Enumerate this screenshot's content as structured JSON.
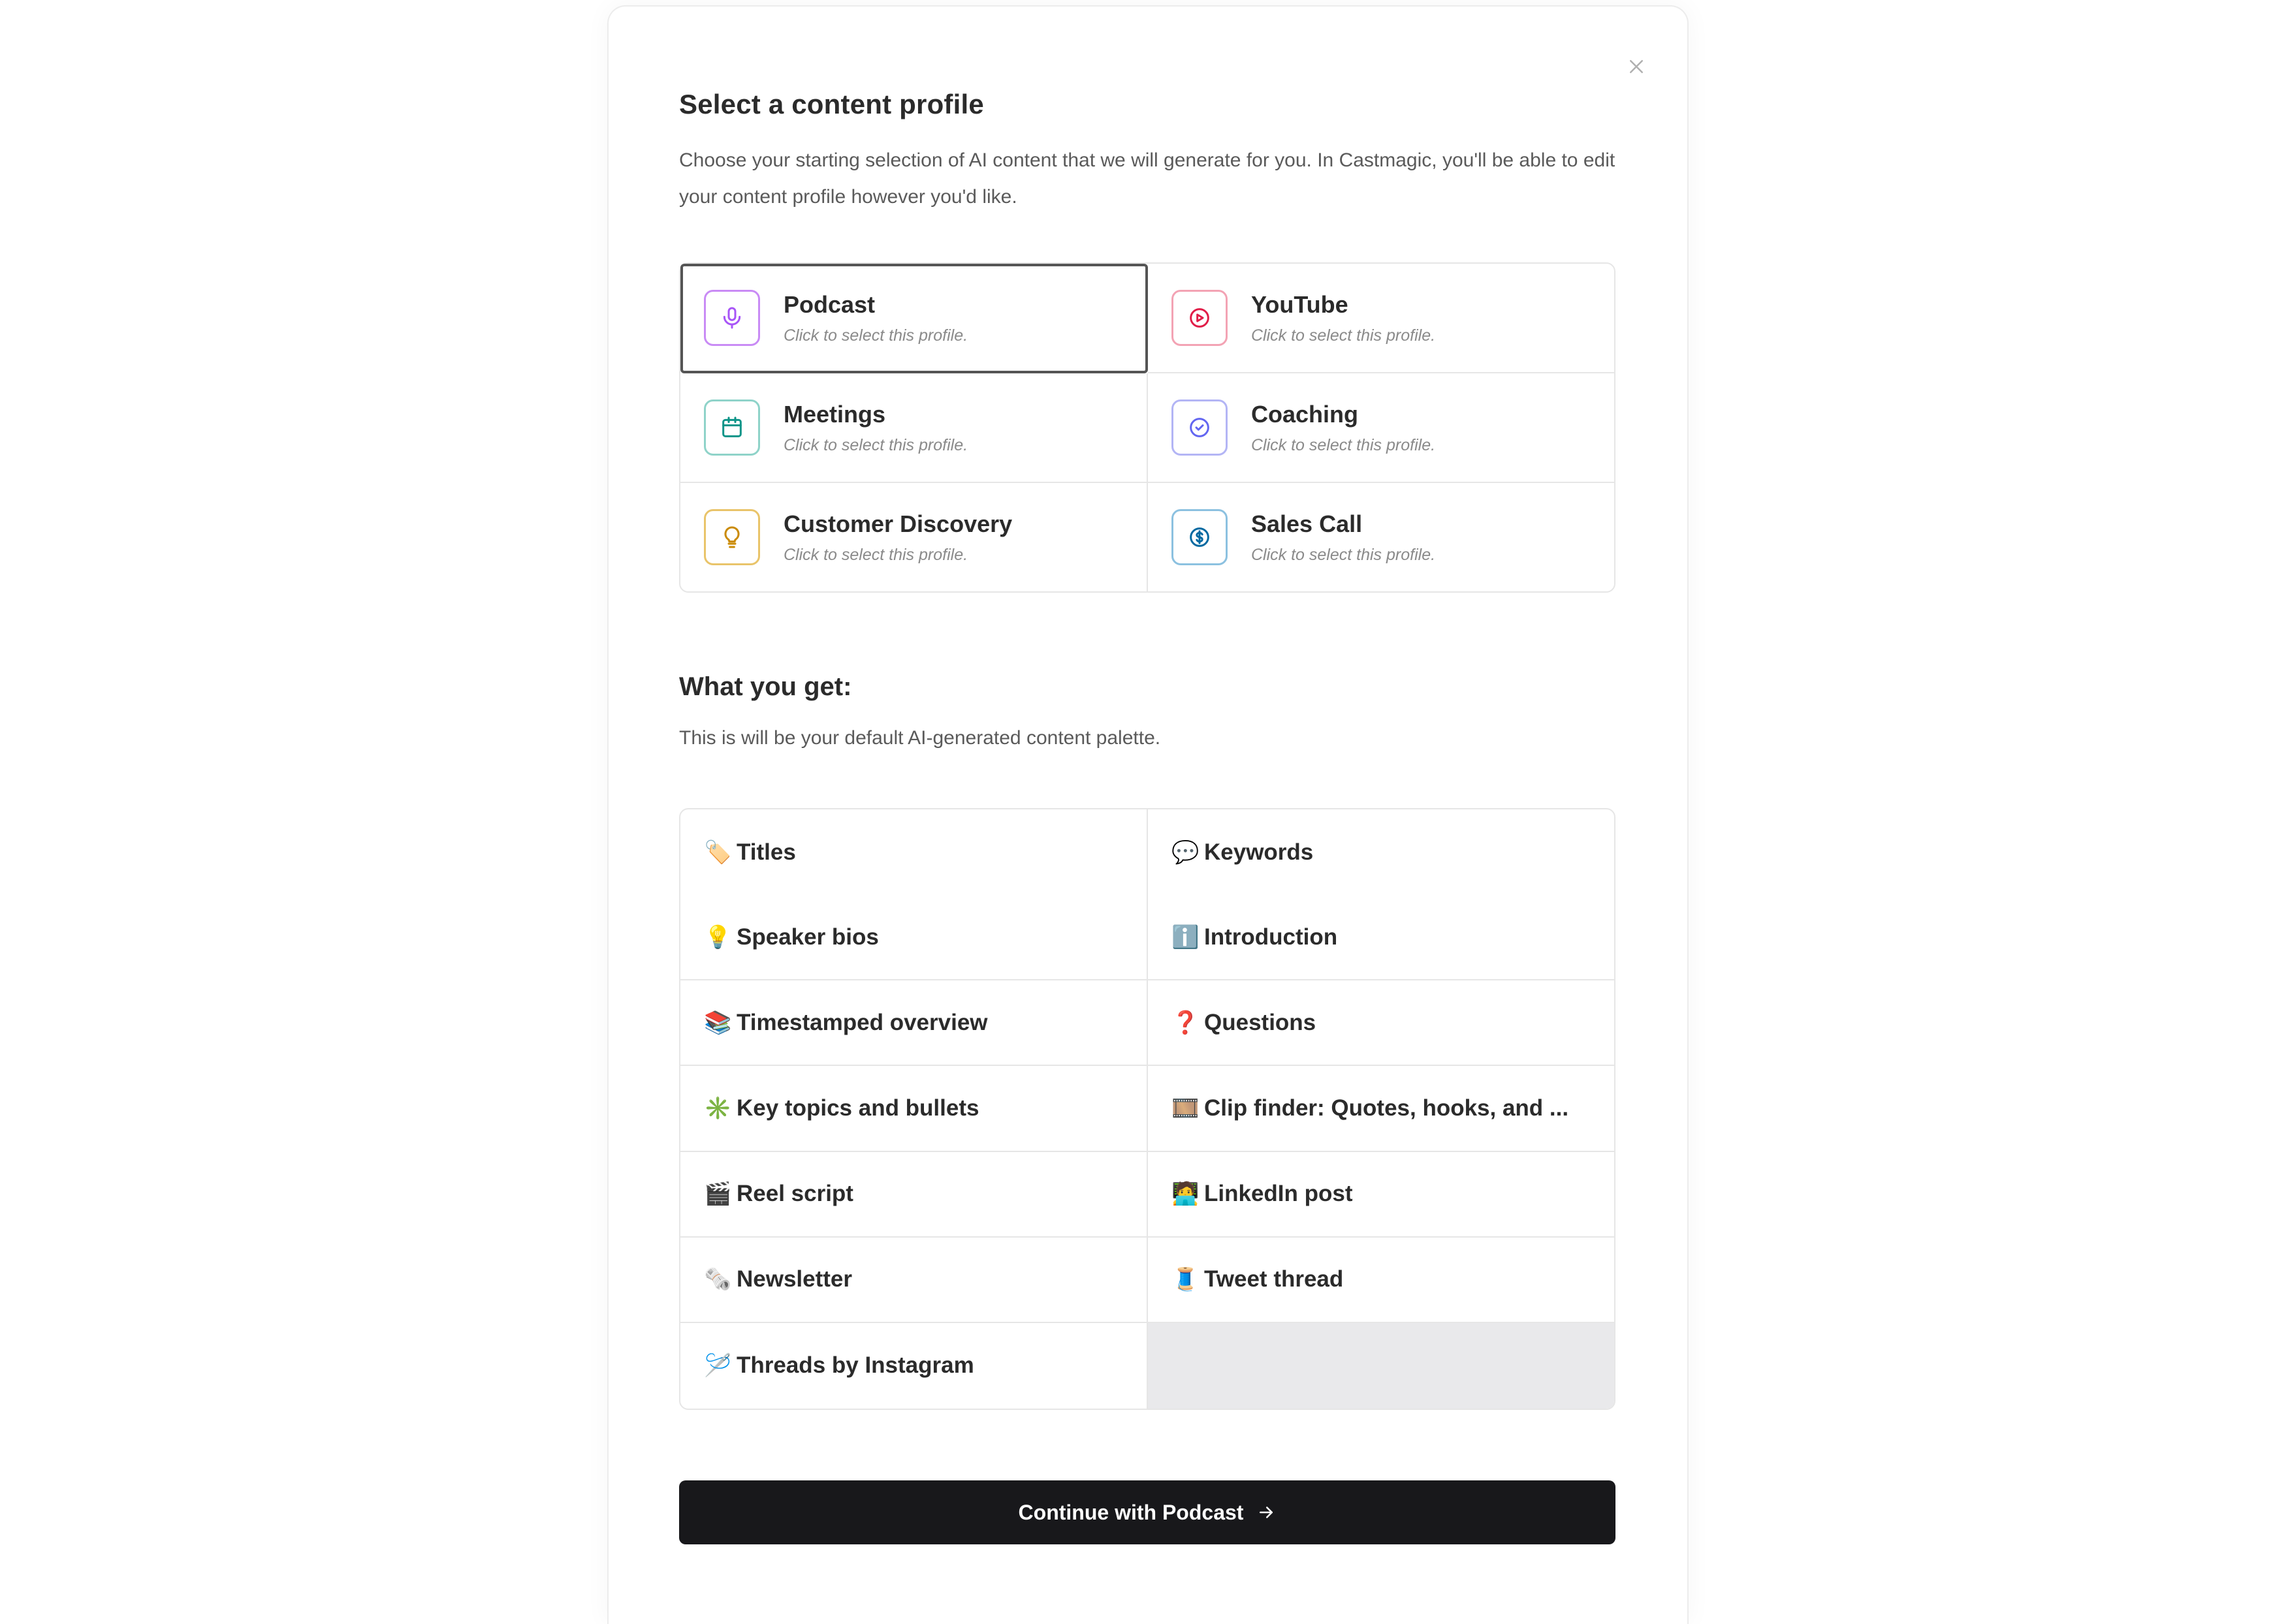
{
  "modal": {
    "title": "Select a content profile",
    "description": "Choose your starting selection of AI content that we will generate for you. In Castmagic, you'll be able to edit your content profile however you'd like."
  },
  "profiles": [
    {
      "name": "Podcast",
      "subtitle": "Click to select this profile.",
      "icon": "microphone-icon",
      "color": "#a855f7",
      "selected": true
    },
    {
      "name": "YouTube",
      "subtitle": "Click to select this profile.",
      "icon": "play-circle-icon",
      "color": "#e11d48",
      "selected": false
    },
    {
      "name": "Meetings",
      "subtitle": "Click to select this profile.",
      "icon": "calendar-icon",
      "color": "#0d9488",
      "selected": false
    },
    {
      "name": "Coaching",
      "subtitle": "Click to select this profile.",
      "icon": "check-circle-icon",
      "color": "#6366f1",
      "selected": false
    },
    {
      "name": "Customer Discovery",
      "subtitle": "Click to select this profile.",
      "icon": "lightbulb-icon",
      "color": "#ca8a04",
      "selected": false
    },
    {
      "name": "Sales Call",
      "subtitle": "Click to select this profile.",
      "icon": "dollar-circle-icon",
      "color": "#0369a1",
      "selected": false
    }
  ],
  "what_you_get": {
    "title": "What you get:",
    "description": "This is will be your default AI-generated content palette."
  },
  "features": [
    {
      "emoji": "🏷️",
      "label": "Titles"
    },
    {
      "emoji": "💬",
      "label": "Keywords"
    },
    {
      "emoji": "💡",
      "label": "Speaker bios"
    },
    {
      "emoji": "ℹ️",
      "label": "Introduction"
    },
    {
      "emoji": "📚",
      "label": "Timestamped overview"
    },
    {
      "emoji": "❓",
      "label": "Questions"
    },
    {
      "emoji": "✳️",
      "label": "Key topics and bullets"
    },
    {
      "emoji": "🎞️",
      "label": "Clip finder: Quotes, hooks, and ..."
    },
    {
      "emoji": "🎬",
      "label": "Reel script"
    },
    {
      "emoji": "🧑‍💻",
      "label": "LinkedIn post"
    },
    {
      "emoji": "🗞️",
      "label": "Newsletter"
    },
    {
      "emoji": "🧵",
      "label": "Tweet thread"
    },
    {
      "emoji": "🪡",
      "label": "Threads by Instagram"
    }
  ],
  "cta": {
    "label": "Continue with Podcast"
  }
}
